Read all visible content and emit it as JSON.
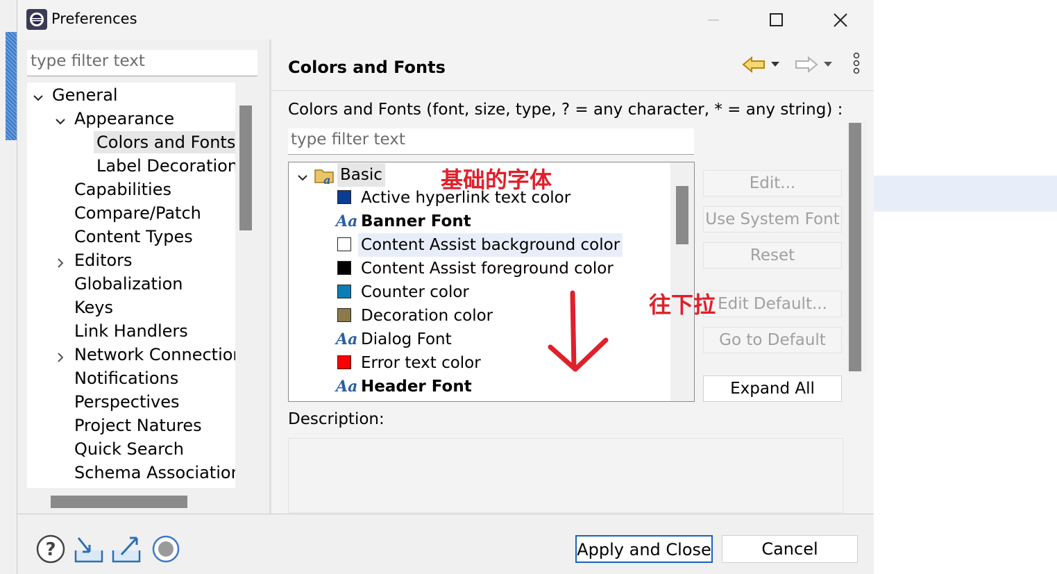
{
  "window": {
    "title": "Preferences"
  },
  "left_panel": {
    "filter_placeholder": "type filter text",
    "tree": [
      {
        "label": "General",
        "level": 0,
        "expanded": true
      },
      {
        "label": "Appearance",
        "level": 1,
        "expanded": true
      },
      {
        "label": "Colors and Fonts",
        "level": 2,
        "selected": true
      },
      {
        "label": "Label Decorations",
        "level": 2
      },
      {
        "label": "Capabilities",
        "level": 1
      },
      {
        "label": "Compare/Patch",
        "level": 1
      },
      {
        "label": "Content Types",
        "level": 1
      },
      {
        "label": "Editors",
        "level": 1,
        "collapsed": true
      },
      {
        "label": "Globalization",
        "level": 1
      },
      {
        "label": "Keys",
        "level": 1
      },
      {
        "label": "Link Handlers",
        "level": 1
      },
      {
        "label": "Network Connections",
        "level": 1,
        "collapsed": true
      },
      {
        "label": "Notifications",
        "level": 1
      },
      {
        "label": "Perspectives",
        "level": 1
      },
      {
        "label": "Project Natures",
        "level": 1
      },
      {
        "label": "Quick Search",
        "level": 1
      },
      {
        "label": "Schema Associations",
        "level": 1
      }
    ]
  },
  "page": {
    "title": "Colors and Fonts",
    "content_label": "Colors and Fonts (font, size, type, ? = any character, * = any string) :",
    "filter_placeholder": "type filter text",
    "category": "Basic",
    "items": [
      {
        "label": "Active hyperlink text color",
        "kind": "color",
        "color": "#0b3d91"
      },
      {
        "label": "Banner Font",
        "kind": "font",
        "bold": true
      },
      {
        "label": "Content Assist background color",
        "kind": "color",
        "color": "#ffffff",
        "highlighted": true
      },
      {
        "label": "Content Assist foreground color",
        "kind": "color",
        "color": "#000000"
      },
      {
        "label": "Counter color",
        "kind": "color",
        "color": "#0a7fb5"
      },
      {
        "label": "Decoration color",
        "kind": "color",
        "color": "#8c7a4a"
      },
      {
        "label": "Dialog Font",
        "kind": "font",
        "bold": false
      },
      {
        "label": "Error text color",
        "kind": "color",
        "color": "#ff0000"
      },
      {
        "label": "Header Font",
        "kind": "font",
        "bold": true
      }
    ],
    "buttons": {
      "edit": "Edit...",
      "use_system_font": "Use System Font",
      "reset": "Reset",
      "edit_default": "Edit Default...",
      "go_to_default": "Go to Default",
      "expand_all": "Expand All"
    },
    "description_label": "Description:"
  },
  "footer": {
    "apply_close": "Apply and Close",
    "cancel": "Cancel"
  },
  "annotations": {
    "basic_font_note": "基础的字体",
    "scroll_down_note": "往下拉"
  }
}
